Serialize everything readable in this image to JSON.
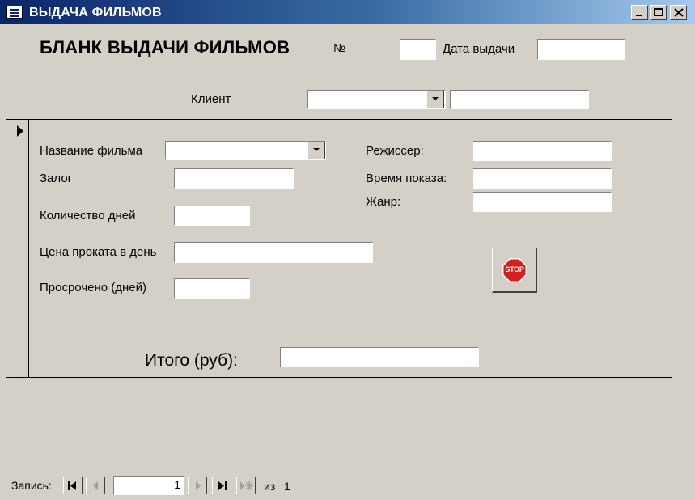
{
  "window": {
    "title": "ВЫДАЧА ФИЛЬМОВ"
  },
  "form": {
    "heading": "БЛАНК ВЫДАЧИ ФИЛЬМОВ",
    "number_label": "№",
    "number_value": "",
    "issue_date_label": "Дата выдачи",
    "issue_date_value": "",
    "client_label": "Клиент",
    "client_value": "",
    "client_extra_value": ""
  },
  "detail": {
    "film_name_label": "Название фильма",
    "film_name_value": "",
    "deposit_label": "Залог",
    "deposit_value": "",
    "days_label": "Количество дней",
    "days_value": "",
    "price_label": "Цена проката в день",
    "price_value": "",
    "overdue_label": "Просрочено (дней)",
    "overdue_value": "",
    "director_label": "Режиссер:",
    "director_value": "",
    "show_time_label": "Время показа:",
    "show_time_value": "",
    "genre_label": "Жанр:",
    "genre_value": "",
    "stop_text": "STOP",
    "total_label": "Итого (руб):",
    "total_value": ""
  },
  "record_nav": {
    "label": "Запись:",
    "current": "1",
    "of_label": "из",
    "total": "1"
  },
  "colors": {
    "titlebar_start": "#0a246a",
    "titlebar_end": "#a6caf0",
    "stop_red": "#d81e1e"
  }
}
